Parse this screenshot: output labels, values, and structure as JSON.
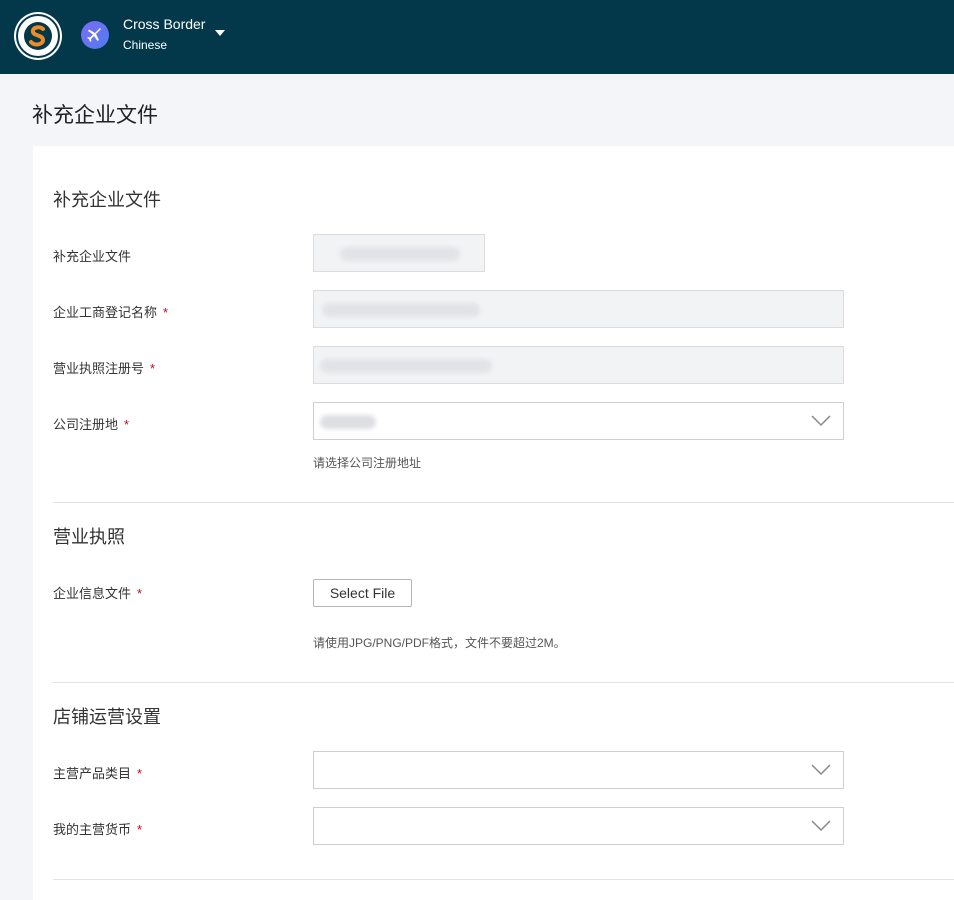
{
  "header": {
    "store_name": "Cross Border",
    "store_language": "Chinese",
    "logo_icon": "shop-logo-icon",
    "store_icon": "airplane-icon",
    "background_color": "#03384b"
  },
  "page": {
    "title": "补充企业文件"
  },
  "sections": {
    "company_docs": {
      "title": "补充企业文件",
      "fields": {
        "supplement_label": "补充企业文件",
        "business_name_label": "企业工商登记名称",
        "license_number_label": "营业执照注册号",
        "registration_place_label": "公司注册地",
        "registration_place_hint": "请选择公司注册地址"
      }
    },
    "business_license": {
      "title": "营业执照",
      "fields": {
        "info_file_label": "企业信息文件",
        "select_file_button": "Select File",
        "file_hint": "请使用JPG/PNG/PDF格式，文件不要超过2M。"
      }
    },
    "store_settings": {
      "title": "店铺运营设置",
      "fields": {
        "main_category_label": "主营产品类目",
        "main_currency_label": "我的主营货币"
      }
    }
  },
  "required_marker": "*",
  "colors": {
    "required": "#d0021b",
    "accent_gradient_start": "#7b6cf6",
    "accent_gradient_end": "#4f7bf0"
  }
}
